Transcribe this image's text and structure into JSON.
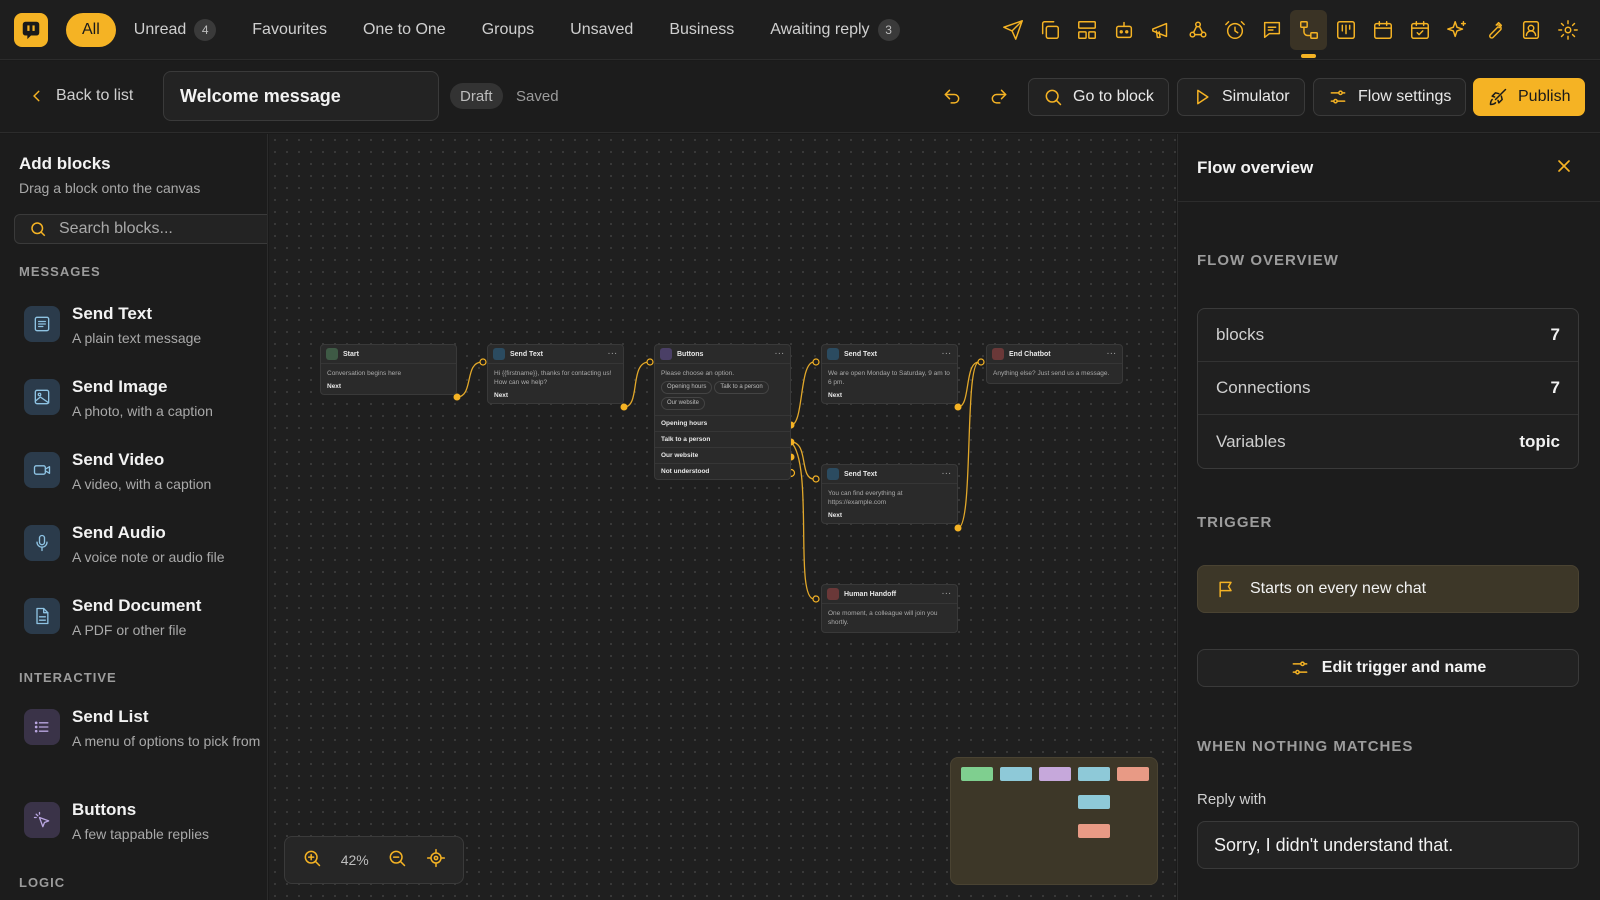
{
  "topnav": {
    "tabs": [
      {
        "label": "All",
        "active": true
      },
      {
        "label": "Unread",
        "badge": "4"
      },
      {
        "label": "Favourites"
      },
      {
        "label": "One to One"
      },
      {
        "label": "Groups"
      },
      {
        "label": "Unsaved"
      },
      {
        "label": "Business"
      },
      {
        "label": "Awaiting reply",
        "badge": "3"
      }
    ],
    "icons": [
      "send-icon",
      "copy-icon",
      "layout-icon",
      "bot-icon",
      "megaphone-icon",
      "webhook-icon",
      "clock-icon",
      "message-icon",
      "flow-icon",
      "kanban-icon",
      "calendar-icon",
      "calendar-check-icon",
      "sparkles-icon",
      "wrench-icon",
      "contact-icon",
      "gear-icon"
    ],
    "active_icon": "flow-icon"
  },
  "header": {
    "back_label": "Back to list",
    "flow_name": "Welcome message",
    "status": "Draft",
    "save_state": "Saved",
    "go_to_block": "Go to block",
    "simulator": "Simulator",
    "flow_settings": "Flow settings",
    "publish": "Publish"
  },
  "sidebar": {
    "title": "Add blocks",
    "subtitle": "Drag a block onto the canvas",
    "search_placeholder": "Search blocks...",
    "messages_heading": "MESSAGES",
    "interactive_heading": "INTERACTIVE",
    "logic_heading": "LOGIC",
    "messages": [
      {
        "name": "Send Text",
        "desc": "A plain text message",
        "icon": "text-icon"
      },
      {
        "name": "Send Image",
        "desc": "A photo, with a caption",
        "icon": "image-icon"
      },
      {
        "name": "Send Video",
        "desc": "A video, with a caption",
        "icon": "video-icon"
      },
      {
        "name": "Send Audio",
        "desc": "A voice note or audio file",
        "icon": "mic-icon"
      },
      {
        "name": "Send Document",
        "desc": "A PDF or other file",
        "icon": "document-icon"
      }
    ],
    "interactive": [
      {
        "name": "Send List",
        "desc": "A menu of options to pick from",
        "icon": "list-icon"
      },
      {
        "name": "Buttons",
        "desc": "A few tappable replies",
        "icon": "tap-icon"
      }
    ]
  },
  "canvas": {
    "zoom": "42%",
    "nodes": {
      "start": {
        "title": "Start",
        "body": "Conversation begins here",
        "next": "Next"
      },
      "text1": {
        "title": "Send Text",
        "body": "Hi {{firstname}}, thanks for contacting us! How can we help?",
        "next": "Next"
      },
      "buttons": {
        "title": "Buttons",
        "body": "Please choose an option.",
        "chips": [
          "Opening hours",
          "Talk to a person",
          "Our website"
        ],
        "options": [
          "Opening hours",
          "Talk to a person",
          "Our website",
          "Not understood"
        ]
      },
      "text2": {
        "title": "Send Text",
        "body": "We are open Monday to Saturday, 9 am to 6 pm.",
        "next": "Next"
      },
      "end": {
        "title": "End Chatbot",
        "body": "Anything else? Just send us a message."
      },
      "text3": {
        "title": "Send Text",
        "body": "You can find everything at https://example.com",
        "next": "Next"
      },
      "handoff": {
        "title": "Human Handoff",
        "body": "One moment, a colleague will join you shortly."
      }
    },
    "colors": {
      "accent": "#f5b324",
      "node_green": "#3e5a45",
      "node_blue": "#2b4b60",
      "node_purple": "#4a3f66",
      "node_red": "#6a3838"
    }
  },
  "panel": {
    "title": "Flow overview",
    "overview_heading": "FLOW OVERVIEW",
    "stats": [
      {
        "label": "blocks",
        "value": "7"
      },
      {
        "label": "Connections",
        "value": "7"
      },
      {
        "label": "Variables",
        "value": "topic"
      }
    ],
    "trigger_heading": "TRIGGER",
    "trigger_text": "Starts on every new chat",
    "edit_trigger": "Edit trigger and name",
    "nomatch_heading": "WHEN NOTHING MATCHES",
    "reply_label": "Reply with",
    "reply_text": "Sorry, I didn't understand that."
  }
}
